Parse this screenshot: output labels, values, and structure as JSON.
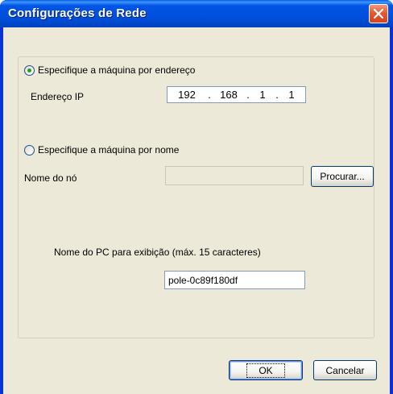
{
  "window": {
    "title": "Configurações de Rede",
    "close_icon": "close-icon"
  },
  "address_option": {
    "label": "Especifique a máquina por endereço",
    "selected": true,
    "ip_label": "Endereço IP",
    "ip_octets": [
      "192",
      "168",
      "1",
      "1"
    ]
  },
  "name_option": {
    "label": "Especifique a máquina por nome",
    "selected": false,
    "node_label": "Nome do nó",
    "node_value": "",
    "browse_label": "Procurar..."
  },
  "pc_name": {
    "label": "Nome do PC para exibição (máx. 15 caracteres)",
    "value": "pole-0c89f180df"
  },
  "buttons": {
    "ok": "OK",
    "cancel": "Cancelar"
  },
  "colors": {
    "titlebar": "#0054e3",
    "dialog_bg": "#ece9d8",
    "close_button": "#e45a32"
  }
}
